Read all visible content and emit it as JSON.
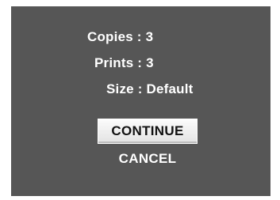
{
  "print_dialog": {
    "copies_line": "Copies : 3",
    "prints_line": "Prints : 3",
    "size_line": "Size : Default",
    "continue_label": "CONTINUE",
    "cancel_label": "CANCEL",
    "selected_option": "CONTINUE"
  },
  "colors": {
    "screen_background": "#565656",
    "text": "#ffffff",
    "selected_background": "#f0f0f0",
    "selected_text": "#111111"
  }
}
